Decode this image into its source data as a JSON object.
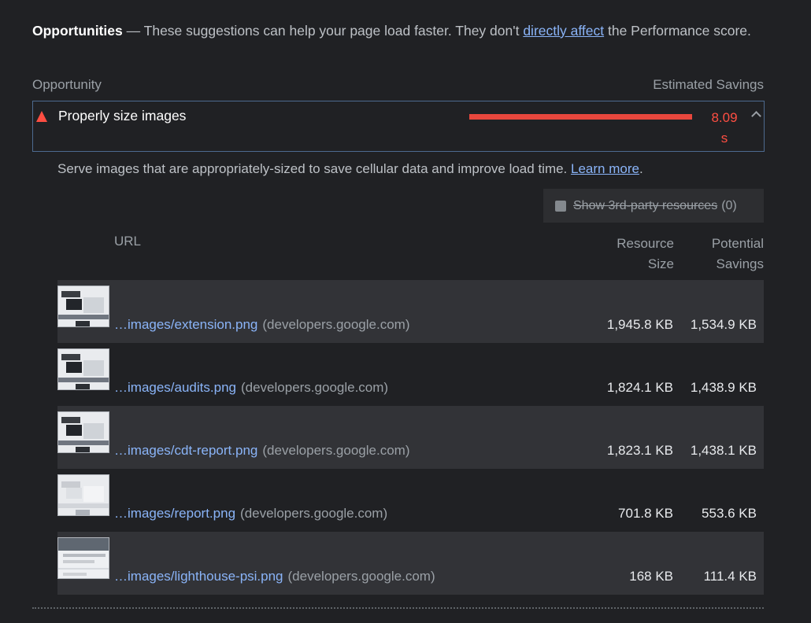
{
  "group": {
    "title": "Opportunities",
    "dash": "—",
    "desc_before": "These suggestions can help your page load faster. They don't",
    "link_text": "directly affect",
    "desc_after": "the Performance score."
  },
  "columns": {
    "left": "Opportunity",
    "right": "Estimated Savings"
  },
  "audit": {
    "title": "Properly size images",
    "savings_value": "8.09",
    "savings_unit": "s",
    "status_color": "#ff4e42"
  },
  "description": {
    "text": "Serve images that are appropriately-sized to save cellular data and improve load time.",
    "link_text": "Learn more",
    "trailing": "."
  },
  "third_party_filter": {
    "label": "Show 3rd-party resources",
    "count": "(0)"
  },
  "table": {
    "headers": {
      "url": "URL",
      "resource_size_1": "Resource",
      "resource_size_2": "Size",
      "potential_savings_1": "Potential",
      "potential_savings_2": "Savings"
    },
    "rows": [
      {
        "path": "…images/extension.png",
        "host": "(developers.google.com)",
        "size": "1,945.8 KB",
        "savings": "1,534.9 KB"
      },
      {
        "path": "…images/audits.png",
        "host": "(developers.google.com)",
        "size": "1,824.1 KB",
        "savings": "1,438.9 KB"
      },
      {
        "path": "…images/cdt-report.png",
        "host": "(developers.google.com)",
        "size": "1,823.1 KB",
        "savings": "1,438.1 KB"
      },
      {
        "path": "…images/report.png",
        "host": "(developers.google.com)",
        "size": "701.8 KB",
        "savings": "553.6 KB"
      },
      {
        "path": "…images/lighthouse-psi.png",
        "host": "(developers.google.com)",
        "size": "168 KB",
        "savings": "111.4 KB"
      }
    ]
  }
}
